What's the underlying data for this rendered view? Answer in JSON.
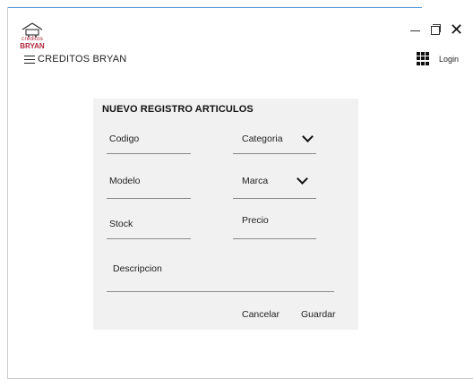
{
  "logo": {
    "top_text": "créditos",
    "brand_text": "BRYAN"
  },
  "navbar": {
    "brand": "CREDITOS BRYAN",
    "login_label": "Login"
  },
  "form": {
    "title": "NUEVO REGISTRO ARTICULOS",
    "fields": {
      "codigo": "Codigo",
      "categoria": "Categoria",
      "modelo": "Modelo",
      "marca": "Marca",
      "stock": "Stock",
      "precio": "Precio",
      "descripcion": "Descripcion"
    },
    "cancel_label": "Cancelar",
    "save_label": "Guardar"
  }
}
